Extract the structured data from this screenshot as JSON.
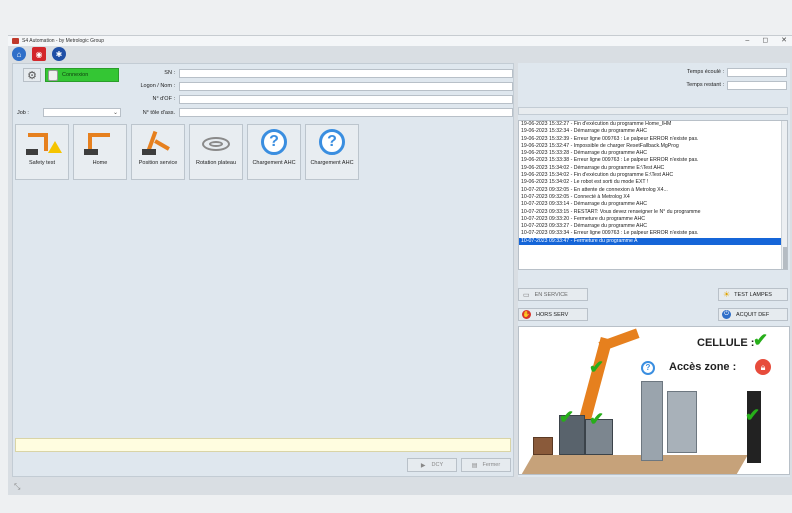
{
  "window": {
    "title": "S4 Automation - by Metrologic Group"
  },
  "window_controls": {
    "minimize": "–",
    "maximize": "◻",
    "close": "✕"
  },
  "quick_toolbar": {
    "icons": [
      "home-icon",
      "alarm-icon",
      "settings-icon"
    ]
  },
  "connection": {
    "button_label": "Connexion"
  },
  "form": {
    "sn_label": "SN :",
    "logon_label": "Logon / Nom :",
    "of_label": "N° d'OF :",
    "assembly_label": "N° tôle d'ass.",
    "job_label": "Job :",
    "sn_value": "",
    "logon_value": "",
    "of_value": "",
    "assembly_value": "",
    "job_value": ""
  },
  "time": {
    "elapsed_label": "Temps écoulé :",
    "remaining_label": "Temps restant :",
    "elapsed_value": "",
    "remaining_value": ""
  },
  "tools": [
    {
      "label": "Safety test",
      "icon": "robot-warning-icon"
    },
    {
      "label": "Home",
      "icon": "robot-home-icon"
    },
    {
      "label": "Position service",
      "icon": "robot-service-icon"
    },
    {
      "label": "Rotation plateau",
      "icon": "rotation-icon"
    },
    {
      "label": "Chargement AHC",
      "icon": "question-icon"
    },
    {
      "label": "Chargement AHC",
      "icon": "question-icon"
    }
  ],
  "bottom_buttons": {
    "dcy": "DCY",
    "close": "Fermer"
  },
  "log": {
    "lines": [
      "19-06-2023 15:32:27 - Fin d'exécution du programme Home_IHM",
      "19-06-2023 15:32:34 - Démarrage du programme AHC",
      "19-06-2023 15:32:39 - Erreur ligne 009763 : Le palpeur ERROR n'existe pas.",
      "19-06-2023 15:32:47 - Impossible de charger ResetFallback.MgProg",
      "19-06-2023 15:33:28 - Démarrage du programme AHC",
      "19-06-2023 15:33:38 - Erreur ligne 009763 : Le palpeur ERROR n'existe pas.",
      "19-06-2023 15:34:02 - Démarrage du programme E:\\Test AHC",
      "19-06-2023 15:34:02 - Fin d'exécution du programme E:\\Test AHC",
      "19-06-2023 15:34:02 - Le robot est sorti du mode EXT !",
      "10-07-2023 09:32:05 - En attente de connexion à Metrolog X4...",
      "10-07-2023 09:32:05 - Connecté à Metrolog X4",
      "10-07-2023 09:33:14 - Démarrage du programme AHC",
      "10-07-2023 09:33:15 - RESTART: Vous devez renseigner le N° du programme",
      "10-07-2023 09:33:20 - Fermeture du programme AHC",
      "10-07-2023 09:33:27 - Démarrage du programme AHC",
      "10-07-2023 09:33:34 - Erreur ligne 009763 : Le palpeur ERROR n'existe pas.",
      "10-07-2023 09:33:47 - Fermeture du programme A"
    ],
    "selected_index": 16
  },
  "status_buttons": {
    "in_service": "EN SERVICE",
    "test_lamps": "TEST LAMPES",
    "out_of_service": "HORS SERV",
    "ack_fault": "ACQUIT DEF"
  },
  "cell": {
    "cell_label": "CELLULE :",
    "access_label": "Accès zone :"
  },
  "colors": {
    "connect_green": "#34c634",
    "selection_blue": "#1565d8",
    "ok_green": "#27ae1a",
    "lock_red": "#e74c3c",
    "robot_orange": "#e6801e"
  }
}
